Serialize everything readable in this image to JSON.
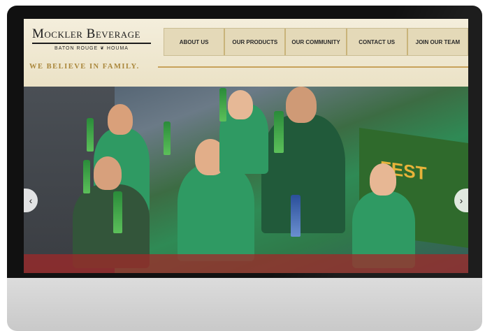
{
  "brand": {
    "name": "Mockler Beverage",
    "subtitle": "BATON ROUGE ❦ HOUMA",
    "tagline": "WE BELIEVE IN FAMILY."
  },
  "nav": {
    "items": [
      {
        "label": "ABOUT US"
      },
      {
        "label": "OUR PRODUCTS"
      },
      {
        "label": "OUR COMMUNITY"
      },
      {
        "label": "CONTACT US"
      },
      {
        "label": "JOIN OUR TEAM"
      }
    ]
  },
  "hero": {
    "sign_text": "FEST",
    "prev_icon": "chevron-left-icon",
    "next_icon": "chevron-right-icon"
  },
  "colors": {
    "header_bg": "#efe8d4",
    "tagline": "#a9863a",
    "shirt_green": "#2f9a63",
    "bezel": "#111111"
  }
}
